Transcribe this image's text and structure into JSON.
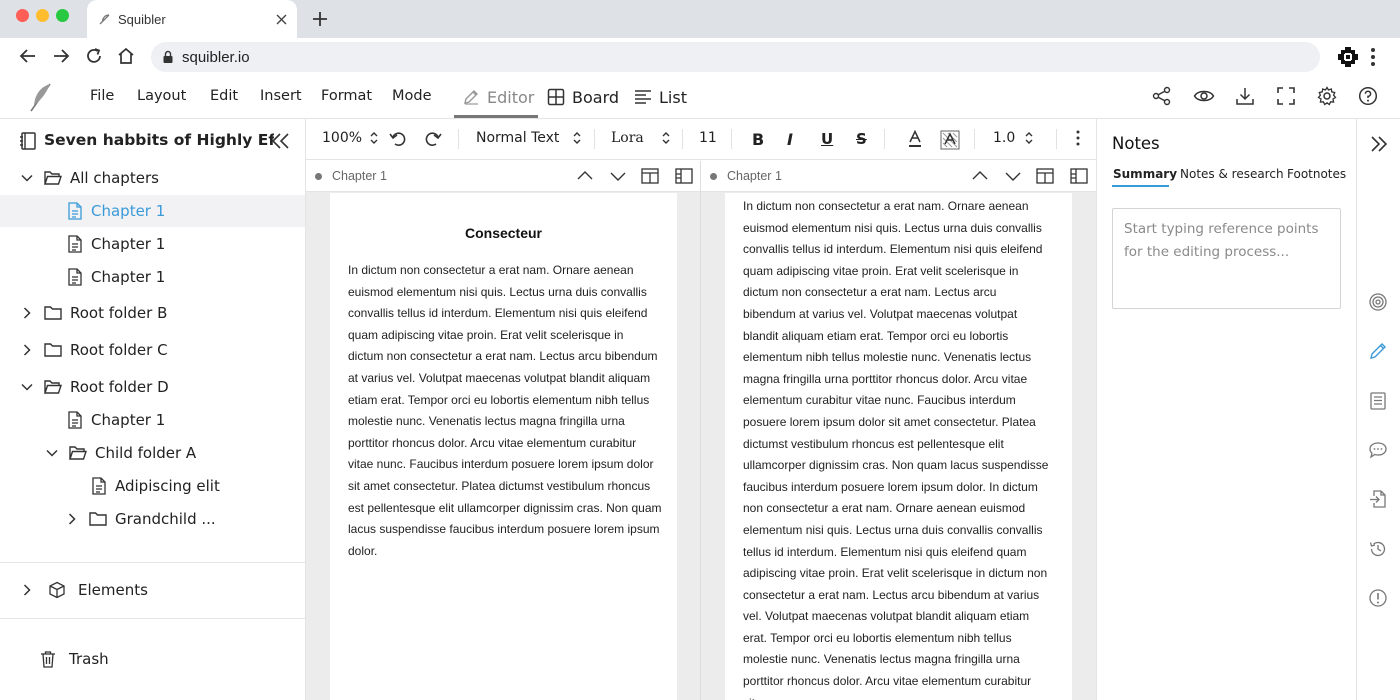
{
  "browser": {
    "tab_title": "Squibler",
    "url": "squibler.io"
  },
  "menu": {
    "file": "File",
    "layout": "Layout",
    "edit": "Edit",
    "insert": "Insert",
    "format": "Format",
    "mode": "Mode"
  },
  "view_tabs": {
    "editor": "Editor",
    "board": "Board",
    "list": "List"
  },
  "sidebar": {
    "project_title": "Seven habbits of Highly Ef...",
    "all_chapters": "All chapters",
    "chapter_1a": "Chapter 1",
    "chapter_1b": "Chapter 1",
    "chapter_1c": "Chapter 1",
    "root_b": "Root folder B",
    "root_c": "Root folder C",
    "root_d": "Root folder D",
    "chapter_1d": "Chapter 1",
    "child_a": "Child folder A",
    "adipiscing": "Adipiscing elit",
    "grandchild": "Grandchild ...",
    "elements": "Elements",
    "trash": "Trash"
  },
  "toolbar": {
    "zoom": "100%",
    "style": "Normal Text",
    "font": "Lora",
    "size": "11",
    "line_spacing": "1.0"
  },
  "left_pane": {
    "header": "Chapter 1",
    "heading": "Consecteur",
    "body": "In dictum non consectetur a erat nam. Ornare aenean euismod elementum nisi quis. Lectus urna duis convallis convallis tellus id interdum. Elementum nisi quis eleifend quam adipiscing vitae proin. Erat velit scelerisque in dictum non consectetur a erat nam. Lectus arcu bibendum at varius vel. Volutpat maecenas volutpat blandit aliquam etiam erat. Tempor orci eu lobortis elementum nibh tellus molestie nunc. Venenatis lectus magna fringilla urna porttitor rhoncus dolor. Arcu vitae elementum curabitur vitae nunc. Faucibus interdum posuere lorem ipsum dolor sit amet consectetur. Platea dictumst vestibulum rhoncus est pellentesque elit ullamcorper dignissim cras. Non quam lacus suspendisse faucibus interdum posuere lorem ipsum dolor."
  },
  "right_pane": {
    "header": "Chapter 1",
    "body": "In dictum non consectetur a erat nam. Ornare aenean euismod elementum nisi quis. Lectus urna duis convallis convallis tellus id interdum. Elementum nisi quis eleifend quam adipiscing vitae proin. Erat velit scelerisque in dictum non consectetur a erat nam. Lectus arcu bibendum at varius vel. Volutpat maecenas volutpat blandit aliquam etiam erat. Tempor orci eu lobortis elementum nibh tellus molestie nunc. Venenatis lectus magna fringilla urna porttitor rhoncus dolor. Arcu vitae elementum curabitur vitae nunc. Faucibus interdum posuere lorem ipsum dolor sit amet consectetur. Platea dictumst vestibulum rhoncus est pellentesque elit ullamcorper dignissim cras. Non quam lacus suspendisse faucibus interdum posuere lorem ipsum dolor. In dictum non consectetur a erat nam. Ornare aenean euismod elementum nisi quis. Lectus urna duis convallis convallis tellus id interdum. Elementum nisi quis eleifend quam adipiscing vitae proin. Erat velit scelerisque in dictum non consectetur a erat nam. Lectus arcu bibendum at varius vel. Volutpat maecenas volutpat blandit aliquam etiam erat. Tempor orci eu lobortis elementum nibh tellus molestie nunc. Venenatis lectus magna fringilla urna porttitor rhoncus dolor. Arcu vitae elementum curabitur vitae nunc."
  },
  "notes": {
    "title": "Notes",
    "tab_summary": "Summary",
    "tab_research": "Notes & research",
    "tab_footnotes": "Footnotes",
    "placeholder": "Start typing reference points for the editing process..."
  },
  "colors": {
    "accent": "#3a9ad9",
    "close_light": "#ff5f57",
    "minimize_light": "#febc2e",
    "zoom_light": "#28c840"
  }
}
